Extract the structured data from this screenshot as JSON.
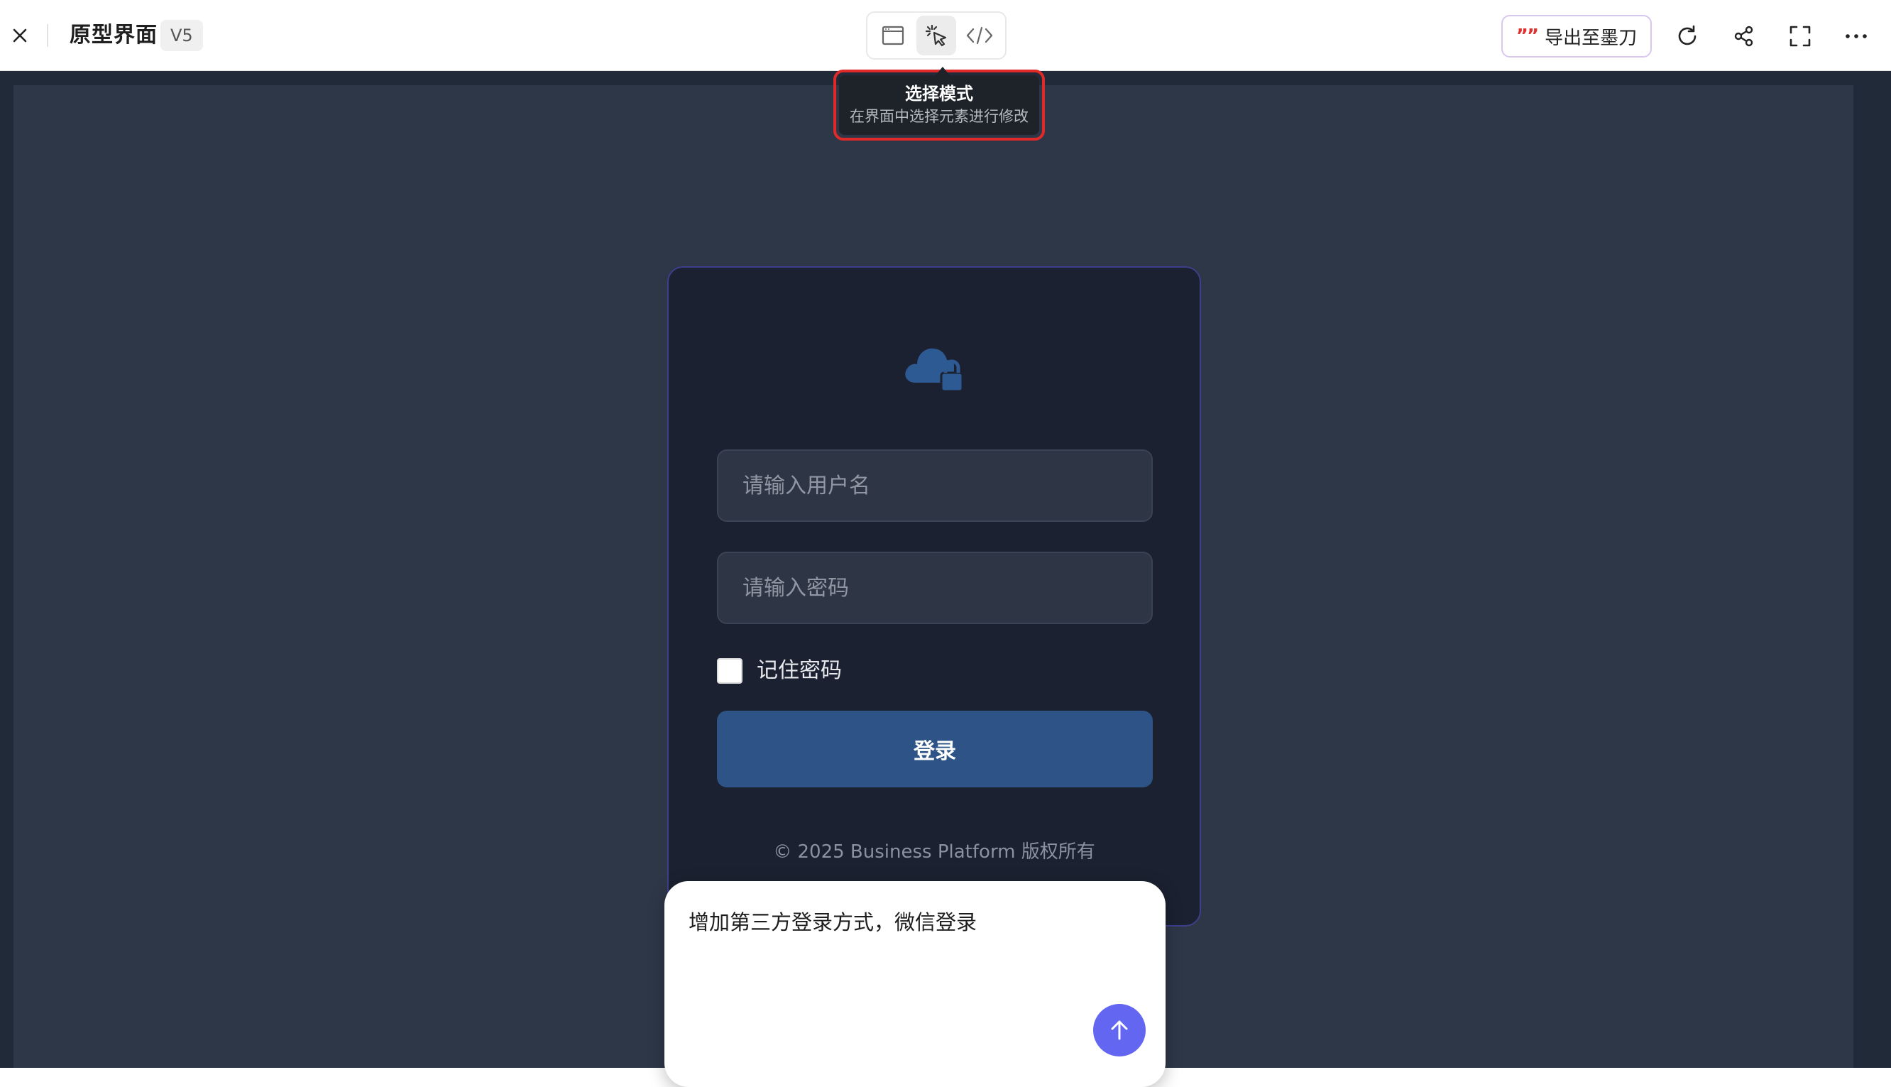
{
  "header": {
    "title": "原型界面",
    "version": "V5",
    "export_label": "导出至墨刀",
    "export_logo": "””",
    "modes": [
      {
        "name": "preview",
        "icon": "window-icon"
      },
      {
        "name": "select",
        "icon": "cursor-click-icon",
        "active": true
      },
      {
        "name": "code",
        "icon": "code-icon"
      }
    ],
    "tools": [
      "refresh-icon",
      "share-icon",
      "fullscreen-icon",
      "more-icon"
    ]
  },
  "tooltip": {
    "title": "选择模式",
    "description": "在界面中选择元素进行修改"
  },
  "login": {
    "username_placeholder": "请输入用户名",
    "password_placeholder": "请输入密码",
    "remember_label": "记住密码",
    "remember_checked": false,
    "submit_label": "登录",
    "copyright": "© 2025 Business Platform 版权所有"
  },
  "chat": {
    "message": "增加第三方登录方式，微信登录"
  },
  "colors": {
    "canvas_bg": "#2e3748",
    "card_bg": "#1b2130",
    "primary_button": "#2e5386",
    "send_button": "#6366f1",
    "highlight": "#e02a2a",
    "logo": "#2d5a93"
  }
}
